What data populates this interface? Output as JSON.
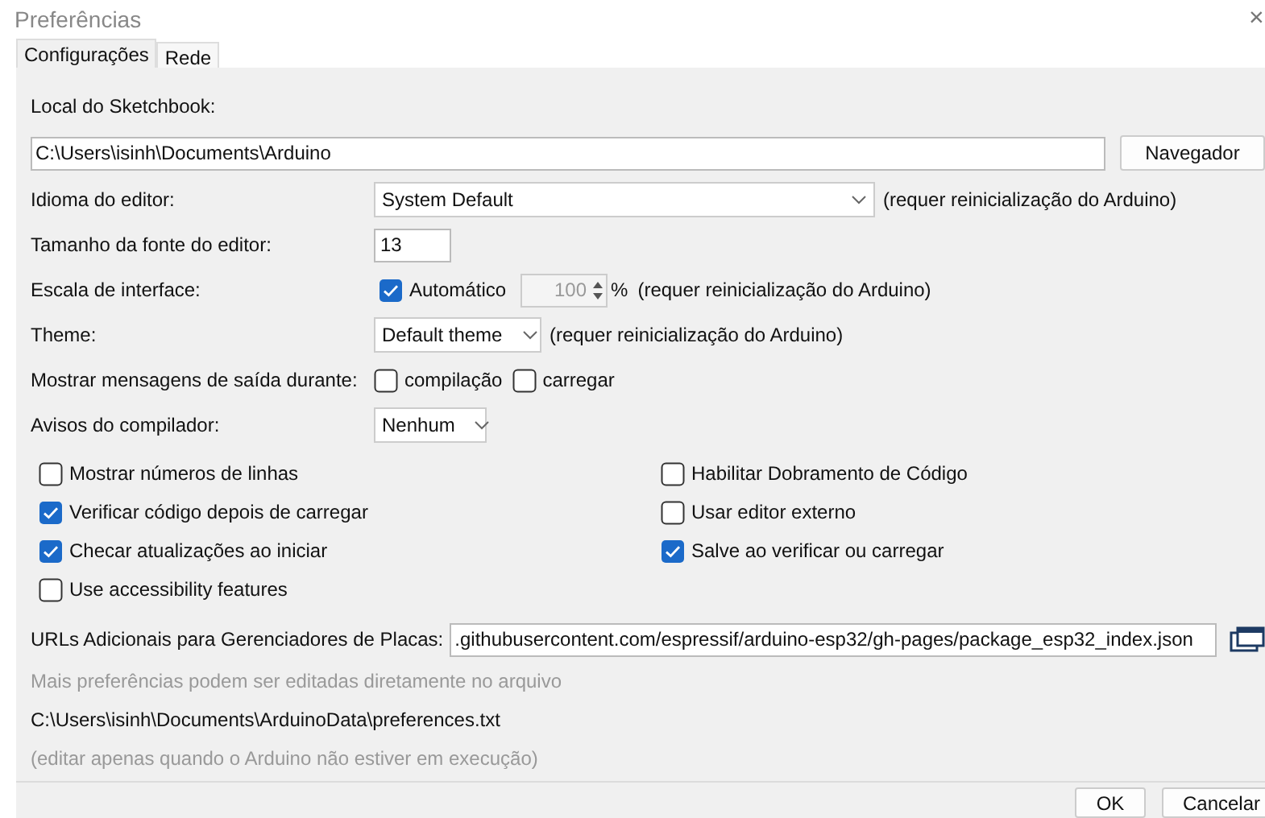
{
  "window": {
    "title": "Preferências",
    "close": "×"
  },
  "tabs": [
    {
      "label": "Configurações",
      "selected": true
    },
    {
      "label": "Rede",
      "selected": false
    }
  ],
  "sketchbook": {
    "label": "Local do Sketchbook:",
    "value": "C:\\Users\\isinh\\Documents\\Arduino",
    "button": "Navegador"
  },
  "rows": [
    {
      "kind": "dropdown",
      "label": "Idioma do editor:",
      "value": "System Default",
      "note": "(requer reinicialização do Arduino)"
    },
    {
      "kind": "text",
      "label": "Tamanho da fonte do editor:",
      "value": "13"
    },
    {
      "kind": "scale",
      "label": "Escala de interface:",
      "checkbox": {
        "label": "Automático",
        "checked": true
      },
      "value": "100",
      "unit": "%",
      "note": "(requer reinicialização do Arduino)"
    },
    {
      "kind": "dropdown",
      "label": "Theme:",
      "value": "Default theme",
      "note": "(requer reinicialização do Arduino)"
    },
    {
      "kind": "checks",
      "label": "Mostrar mensagens de saída durante:",
      "options": [
        {
          "label": "compilação",
          "checked": false
        },
        {
          "label": "carregar",
          "checked": false
        }
      ]
    },
    {
      "kind": "dropdown",
      "label": "Avisos do compilador:",
      "value": "Nenhum"
    }
  ],
  "options": [
    {
      "label": "Mostrar números de linhas",
      "checked": false
    },
    {
      "label": "Habilitar Dobramento de Código",
      "checked": false
    },
    {
      "label": "Verificar código depois de carregar",
      "checked": true
    },
    {
      "label": "Usar editor externo",
      "checked": false
    },
    {
      "label": "Checar atualizações ao iniciar",
      "checked": true
    },
    {
      "label": "Salve ao verificar ou carregar",
      "checked": true
    },
    {
      "label": "Use accessibility features",
      "checked": false
    }
  ],
  "urls": {
    "label": "URLs Adicionais para Gerenciadores de Placas:",
    "value": ".githubusercontent.com/espressif/arduino-esp32/gh-pages/package_esp32_index.json"
  },
  "info": {
    "hint": "Mais preferências podem ser editadas diretamente no arquivo",
    "path": "C:\\Users\\isinh\\Documents\\ArduinoData\\preferences.txt",
    "note": "(editar apenas quando o Arduino não estiver em execução)"
  },
  "buttons": [
    "OK",
    "Cancelar"
  ]
}
